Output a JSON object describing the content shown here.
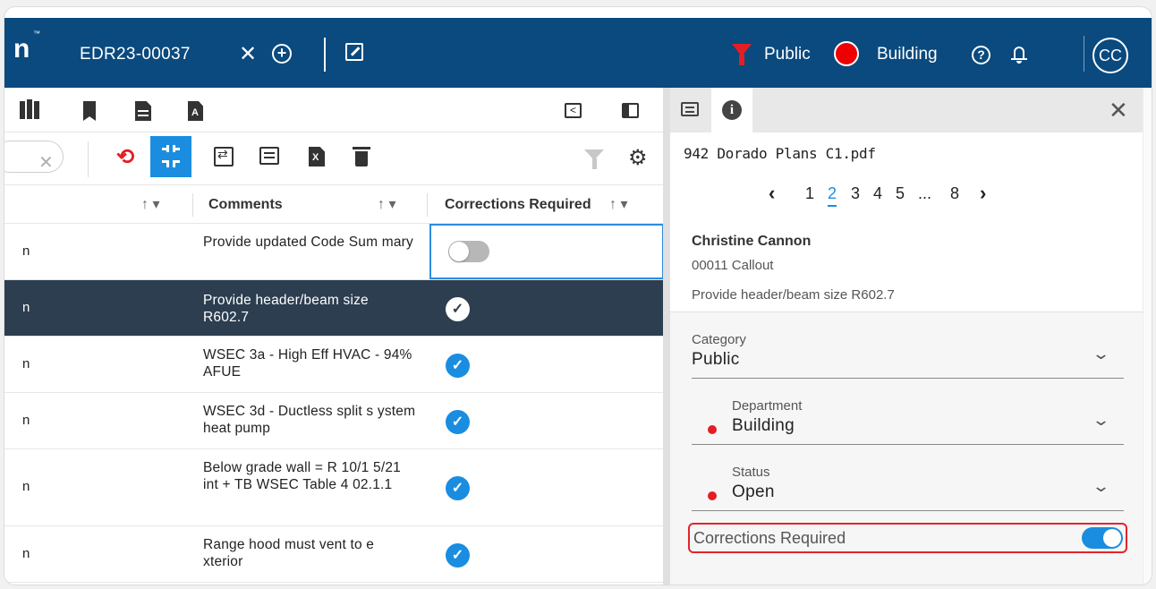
{
  "header": {
    "logo_fragment": "n",
    "logo_tm": "™",
    "tab_title": "EDR23-00037",
    "close_glyph": "✕",
    "add_glyph": "+",
    "filter_label": "Public",
    "department_label": "Building",
    "help_glyph": "?",
    "avatar_initials": "CC",
    "colors": {
      "bar": "#0a4a7e",
      "filter": "#e31e24",
      "department_dot": "#ee0000"
    },
    "icons": [
      "close-icon",
      "add-circle-icon",
      "popout-icon",
      "filter-icon",
      "help-icon",
      "bell-icon"
    ]
  },
  "left": {
    "iconbar": {
      "collapse_glyph": "<",
      "icons": [
        "map-icon",
        "bookmark-icon",
        "document-icon",
        "tagged-document-icon",
        "collapse-left-icon",
        "panel-icon"
      ]
    },
    "toolbar": {
      "search_clear_glyph": "✕",
      "sync_glyph": "⟲",
      "gear_glyph": "⚙",
      "icons": [
        "sync-icon",
        "compress-icon",
        "swap-icon",
        "comment-icon",
        "excel-icon",
        "trash-icon",
        "funnel-icon",
        "gear-icon"
      ]
    },
    "table": {
      "columns": [
        {
          "label": "",
          "sort": "↑ ▾"
        },
        {
          "label": "Comments",
          "sort": "↑ ▾"
        },
        {
          "label": "Corrections Required",
          "sort": "↑ ▾"
        }
      ],
      "rows": [
        {
          "name": "n",
          "comment": "Provide updated Code Sum mary",
          "corrections": false,
          "selected": false,
          "check": "✓"
        },
        {
          "name": "n",
          "comment": "Provide header/beam size R602.7",
          "corrections": true,
          "selected": true,
          "check": "✓"
        },
        {
          "name": "n",
          "comment": "WSEC 3a - High Eff HVAC - 94% AFUE",
          "corrections": true,
          "selected": false,
          "check": "✓"
        },
        {
          "name": "n",
          "comment": "WSEC 3d - Ductless split s ystem heat pump",
          "corrections": true,
          "selected": false,
          "check": "✓"
        },
        {
          "name": "n",
          "comment": "Below grade wall = R 10/1 5/21 int + TB WSEC Table 4 02.1.1",
          "corrections": true,
          "selected": false,
          "check": "✓"
        },
        {
          "name": "n",
          "comment": "Range hood must vent to e xterior",
          "corrections": true,
          "selected": false,
          "check": "✓"
        }
      ]
    }
  },
  "right": {
    "tabs": {
      "icons": [
        "chat-icon",
        "info-icon"
      ],
      "info_glyph": "i",
      "close_glyph": "✕"
    },
    "file_name": "942 Dorado Plans C1.pdf",
    "pager": {
      "prev": "‹",
      "pages": [
        "1",
        "2",
        "3",
        "4",
        "5",
        "...",
        "8"
      ],
      "current": "2",
      "next": "›"
    },
    "author": "Christine Cannon",
    "callout_id": "00011 Callout",
    "callout_text": "Provide header/beam size R602.7",
    "fields": {
      "category": {
        "label": "Category",
        "value": "Public",
        "chevron": "⌄"
      },
      "department": {
        "label": "Department",
        "value": "Building",
        "chevron": "⌄"
      },
      "status": {
        "label": "Status",
        "value": "Open",
        "chevron": "⌄"
      }
    },
    "corrections": {
      "label": "Corrections Required",
      "value": true,
      "highlight": "#e3242b"
    }
  }
}
